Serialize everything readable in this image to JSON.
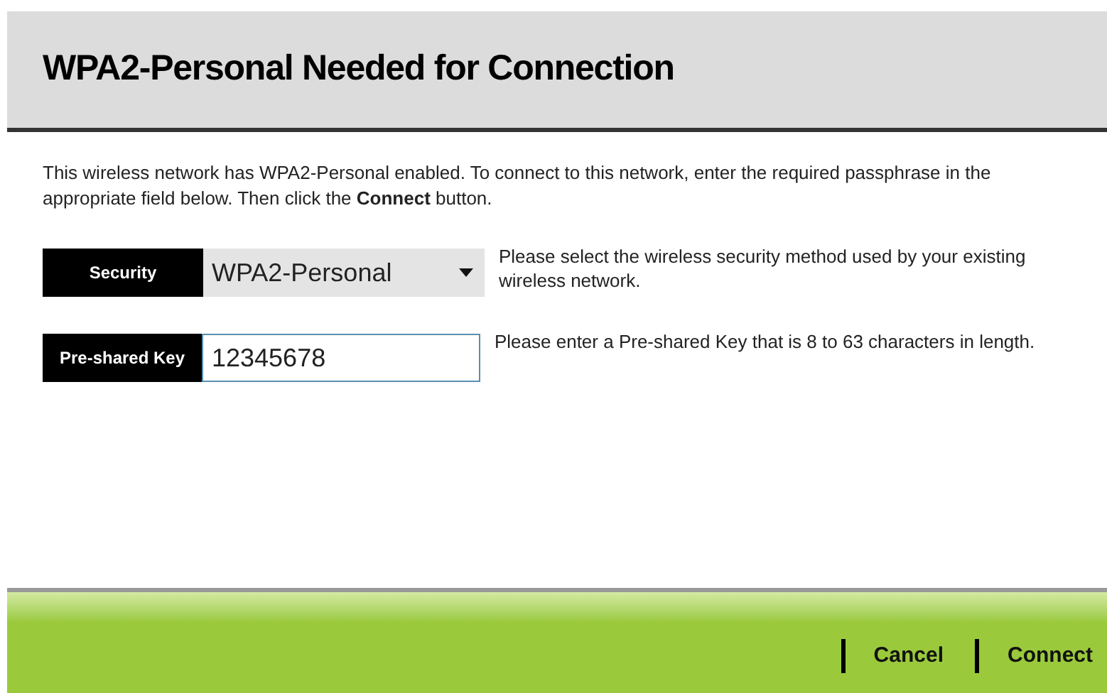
{
  "title": "WPA2-Personal Needed for Connection",
  "intro": "This wireless network has WPA2-Personal enabled. To connect to this network, enter the required passphrase in the appropriate field below. Then click the **Connect** button.",
  "fields": [
    {
      "kind": "select",
      "label": "Security",
      "value": "WPA2-Personal",
      "help": "Please select the wireless security method used by your existing wireless network."
    },
    {
      "kind": "text",
      "label": "Pre-shared Key",
      "value": "12345678",
      "help": "Please enter a Pre-shared Key that is 8 to 63 characters in length."
    }
  ],
  "buttons": [
    "Cancel",
    "Connect"
  ]
}
